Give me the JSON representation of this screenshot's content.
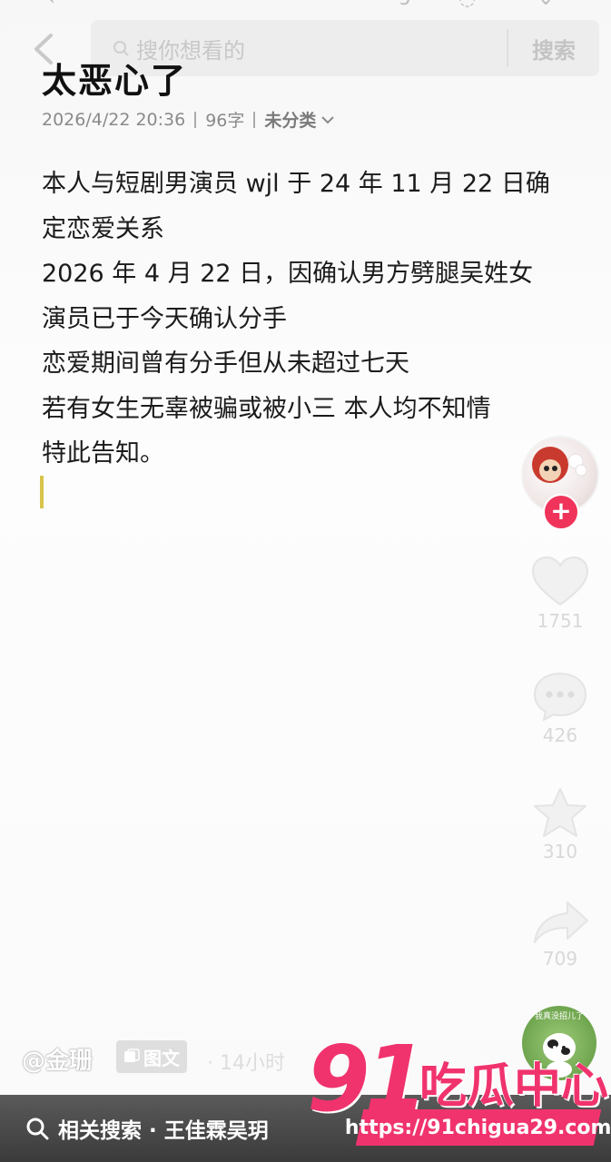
{
  "search": {
    "placeholder": "搜你想看的",
    "button_label": "搜索"
  },
  "note": {
    "title": "太恶心了",
    "date": "2026/4/22 20:36",
    "word_count": "96字",
    "category": "未分类",
    "lines": [
      "本人与短剧男演员 wjl 于 24 年 11 月 22 日确",
      "定恋爱关系",
      "2026 年 4 月 22 日，因确认男方劈腿吴姓女",
      "演员已于今天确认分手",
      "恋爱期间曾有分手但从未超过七天",
      "若有女生无辜被骗或被小三 本人均不知情",
      "特此告知。"
    ]
  },
  "actions": {
    "likes": "1751",
    "comments": "426",
    "favorites": "310",
    "shares": "709"
  },
  "author": {
    "name": "@金珊",
    "type_badge": "图文",
    "time": "· 14小时"
  },
  "music_disc_text": "我真没招儿了",
  "related": {
    "label": "相关搜索 · 王佳霖吴玥"
  },
  "watermark": {
    "number": "91",
    "name": "吃瓜中心",
    "url": "https://91chigua29.com"
  },
  "colors": {
    "follow": "#f0335a",
    "watermark": "#f0336d",
    "cursor": "#d8c44a"
  }
}
